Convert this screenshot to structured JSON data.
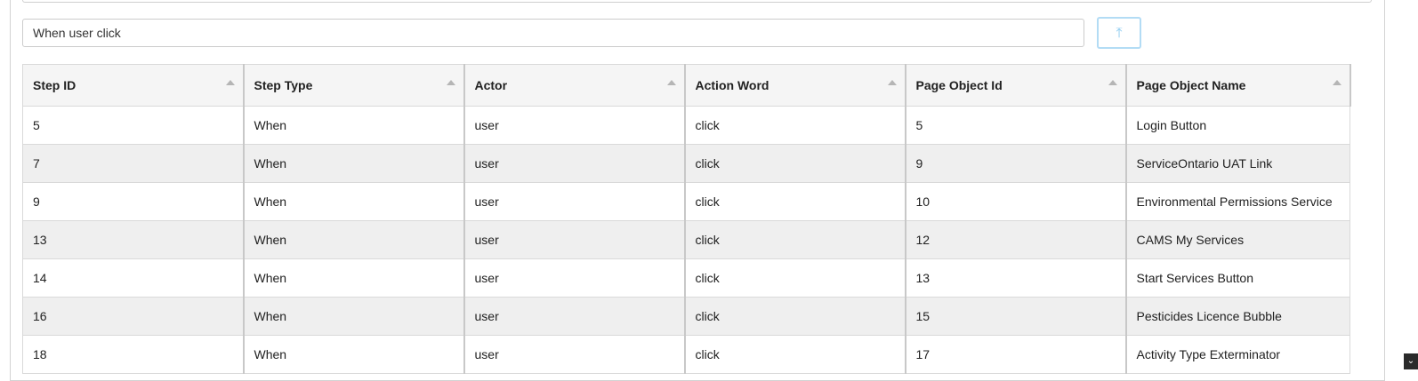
{
  "search": {
    "value": "When user click",
    "upload_icon": "upload-arrow-icon",
    "upload_glyph": "⤒"
  },
  "table": {
    "columns": [
      "Step ID",
      "Step Type",
      "Actor",
      "Action Word",
      "Page Object Id",
      "Page Object Name"
    ],
    "rows": [
      [
        "5",
        "When",
        "user",
        "click",
        "5",
        "Login Button"
      ],
      [
        "7",
        "When",
        "user",
        "click",
        "9",
        "ServiceOntario UAT Link"
      ],
      [
        "9",
        "When",
        "user",
        "click",
        "10",
        "Environmental Permissions Service"
      ],
      [
        "13",
        "When",
        "user",
        "click",
        "12",
        "CAMS My Services"
      ],
      [
        "14",
        "When",
        "user",
        "click",
        "13",
        "Start Services Button"
      ],
      [
        "16",
        "When",
        "user",
        "click",
        "15",
        "Pesticides Licence Bubble"
      ],
      [
        "18",
        "When",
        "user",
        "click",
        "17",
        "Activity Type Exterminator"
      ]
    ]
  },
  "scrollbar": {
    "down_glyph": "⌄"
  },
  "colors": {
    "accent_light_blue": "#b3dcf5",
    "header_bg": "#f5f5f5",
    "stripe_bg": "#efefef"
  }
}
